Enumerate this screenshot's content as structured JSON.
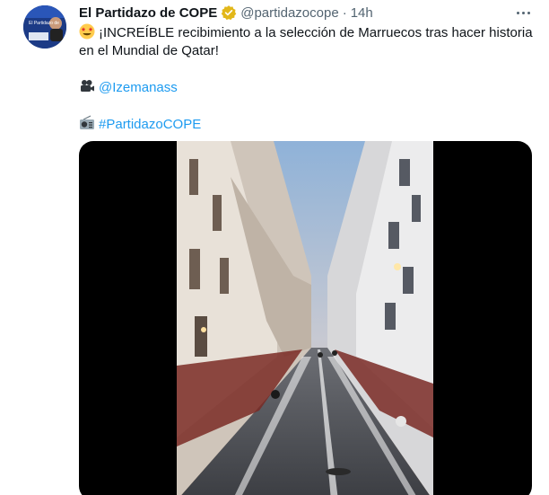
{
  "author": {
    "display_name": "El Partidazo de COPE",
    "handle": "@partidazocope",
    "separator": "·",
    "time": "14h",
    "avatar_caption": "El Partidazo de"
  },
  "tweet": {
    "text_line1": "¡INCREÍBLE recibimiento a la selección de Marruecos tras hacer historia",
    "text_line2": "en el Mundial de Qatar!",
    "mention": "@Izemanass",
    "hashtag": "#PartidazoCOPE"
  },
  "icons": {
    "verified": "verified-badge-icon",
    "more": "more-options-icon",
    "star_struck": "star-struck-emoji",
    "camera": "movie-camera-emoji",
    "radio": "radio-emoji"
  },
  "colors": {
    "link": "#1d9bf0",
    "secondary_text": "#536471",
    "verified_gold": "#e2b719",
    "media_bg": "#000000"
  }
}
